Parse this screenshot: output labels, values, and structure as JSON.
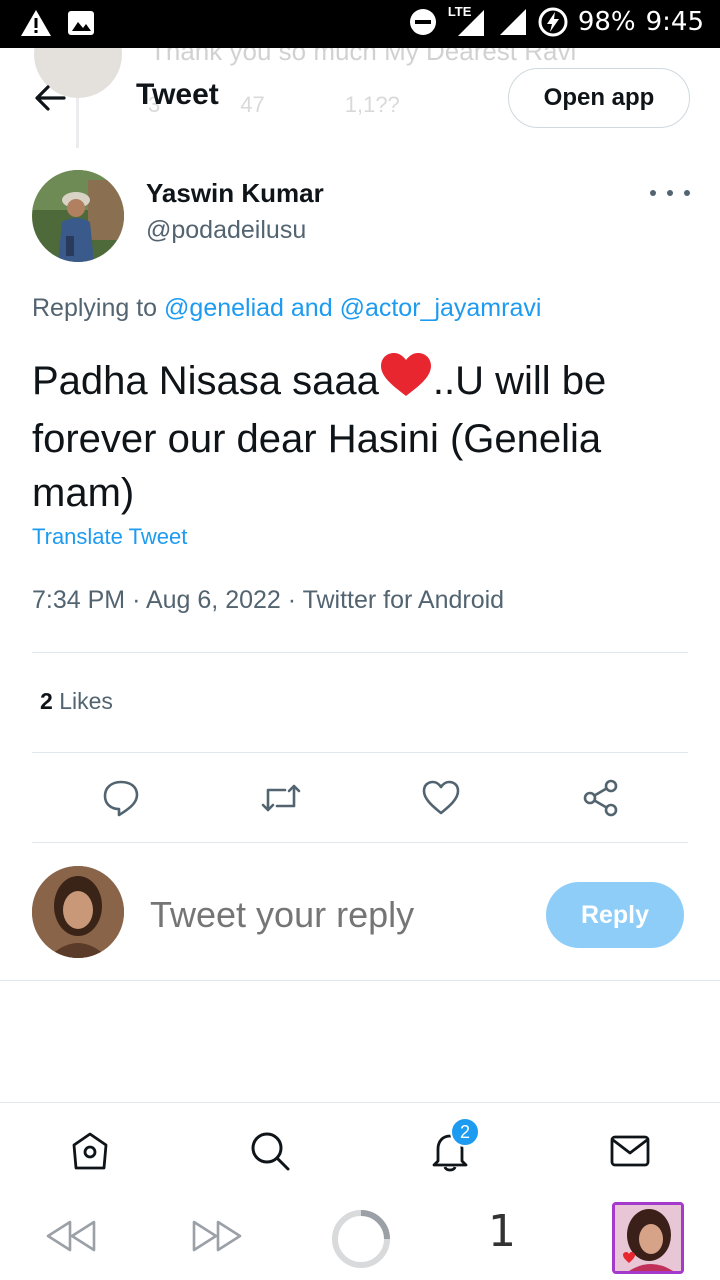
{
  "status_bar": {
    "network": "LTE",
    "battery": "98%",
    "time": "9:45"
  },
  "background_tweet": {
    "text": "Thank you so much My Dearest Ravi",
    "reply_count": "3",
    "retweet_count": "47",
    "like_count": "1,1??"
  },
  "header": {
    "title": "Tweet",
    "open_app_label": "Open app"
  },
  "tweet": {
    "author_name": "Yaswin Kumar",
    "author_handle": "@podadeilusu",
    "replying_prefix": "Replying to",
    "replying_mention_1": "@geneliad",
    "replying_and": "and",
    "replying_mention_2": "@actor_jayamravi",
    "text_before_emoji": "Padha Nisasa saaa",
    "emoji": "red-heart",
    "text_after_emoji": "..U will be forever our dear Hasini (Genelia mam)",
    "translate_label": "Translate Tweet",
    "time": "7:34 PM",
    "date": "Aug 6, 2022",
    "source": "Twitter for Android",
    "likes_count": "2",
    "likes_label": "Likes"
  },
  "reply_composer": {
    "placeholder": "Tweet your reply",
    "button_label": "Reply"
  },
  "bottom_nav": {
    "notifications_badge": "2"
  },
  "browser_bar": {
    "tab_count": "1"
  },
  "colors": {
    "accent": "#1d9bf0",
    "reply_button_disabled": "#8ecdf8",
    "text_primary": "#0f1419",
    "text_secondary": "#536471",
    "divider": "#e1e8ed"
  }
}
